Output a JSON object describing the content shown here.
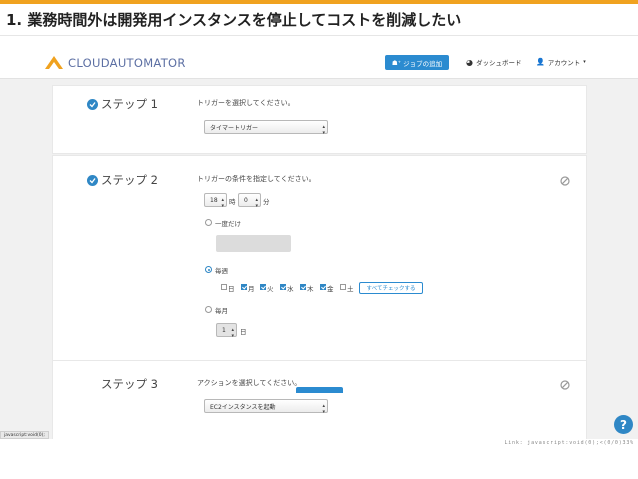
{
  "slide": {
    "title": "1. 業務時間外は開発用インスタンスを停止してコストを削減したい",
    "accent_color": "#f0a21f"
  },
  "app": {
    "logo_text": "CLOUDAUTOMATOR",
    "add_job_label": "ジョブの追加",
    "dashboard_label": "ダッシュボード",
    "account_label": "アカウント",
    "primary_color": "#2b8bd0"
  },
  "step1": {
    "label": "ステップ 1",
    "instruction": "トリガーを選択してください。",
    "trigger_select": "タイマートリガー"
  },
  "step2": {
    "label": "ステップ 2",
    "instruction": "トリガーの条件を指定してください。",
    "hour_value": "18",
    "hour_unit": "時",
    "minute_value": "0",
    "minute_unit": "分",
    "once_label": "一度だけ",
    "weekly_label": "毎週",
    "days": [
      {
        "label": "日",
        "checked": false
      },
      {
        "label": "月",
        "checked": true
      },
      {
        "label": "火",
        "checked": true
      },
      {
        "label": "水",
        "checked": true
      },
      {
        "label": "木",
        "checked": true
      },
      {
        "label": "金",
        "checked": true
      },
      {
        "label": "土",
        "checked": false
      }
    ],
    "check_all_label": "すべてチェックする",
    "monthly_label": "毎月",
    "day_value": "1",
    "day_unit": "日"
  },
  "step3": {
    "label": "ステップ 3",
    "instruction": "アクションを選択してください。",
    "action_select": "EC2インスタンスを起動"
  },
  "statusbar": {
    "left_text": "javascript:void(0);",
    "right_text": "Link: javascript:void(0);<(0/0)33%"
  },
  "help_label": "?"
}
